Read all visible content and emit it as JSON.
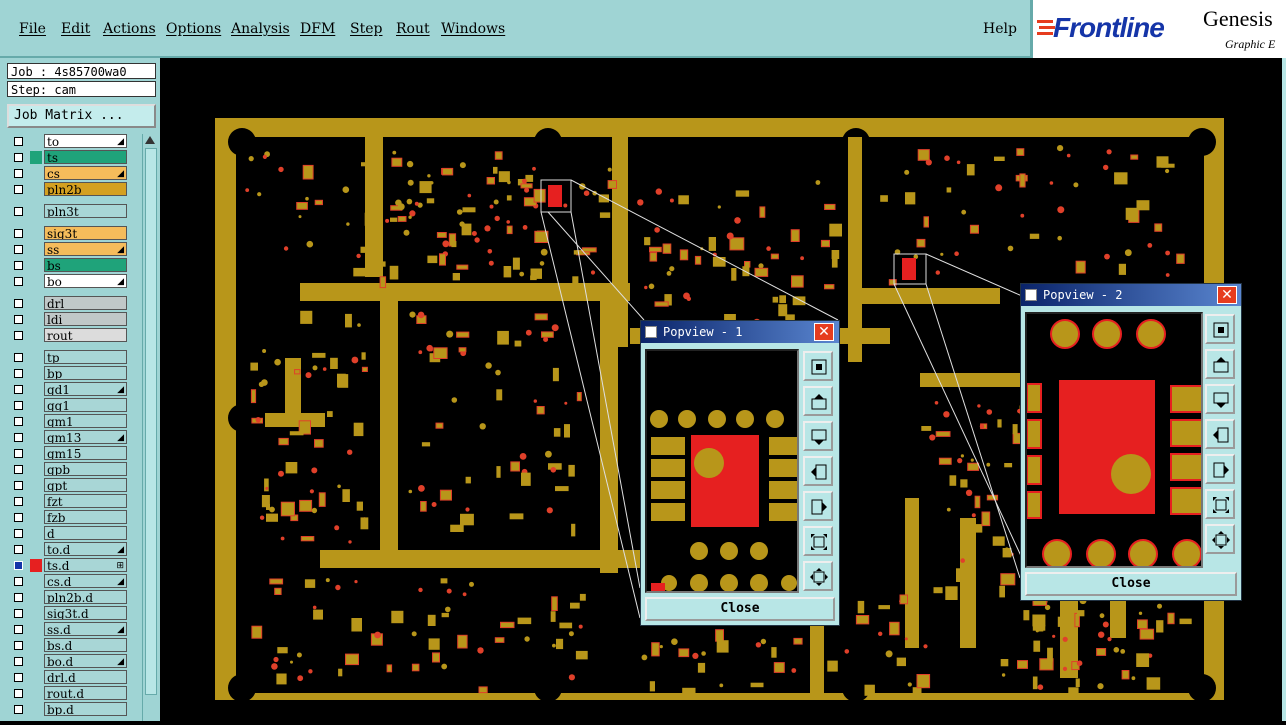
{
  "menu": {
    "items": [
      "File",
      "Edit",
      "Actions",
      "Options",
      "Analysis",
      "DFM",
      "Step",
      "Rout",
      "Windows"
    ],
    "help": "Help"
  },
  "logo": {
    "brand": "Frontline",
    "product": "Genesis",
    "tagline": "Graphic E"
  },
  "job": {
    "job_label": "Job : 4s85700wa0",
    "step_label": "Step: cam",
    "matrix_button": "Job Matrix ..."
  },
  "layers": [
    {
      "name": "to",
      "color": "#ffffff",
      "mark": "◢",
      "ind": ""
    },
    {
      "name": "ts",
      "color": "#1fa37a",
      "mark": "",
      "ind": "#1fa37a"
    },
    {
      "name": "cs",
      "color": "#f5bc5b",
      "mark": "◢",
      "ind": ""
    },
    {
      "name": "pln2b",
      "color": "#d4a020",
      "mark": "",
      "ind": ""
    },
    {
      "name": "pln3t",
      "color": "#a8d6d6",
      "mark": "",
      "ind": ""
    },
    {
      "name": "sig3t",
      "color": "#f5bc5b",
      "mark": "",
      "ind": ""
    },
    {
      "name": "ss",
      "color": "#f5bc5b",
      "mark": "◢",
      "ind": ""
    },
    {
      "name": "bs",
      "color": "#1fa37a",
      "mark": "",
      "ind": ""
    },
    {
      "name": "bo",
      "color": "#ffffff",
      "mark": "◢",
      "ind": ""
    },
    {
      "name": "drl",
      "color": "#c0c8c8",
      "mark": "",
      "ind": ""
    },
    {
      "name": "ldi",
      "color": "#c0c8c8",
      "mark": "",
      "ind": ""
    },
    {
      "name": "rout",
      "color": "#dcdcdc",
      "mark": "",
      "ind": ""
    },
    {
      "name": "tp",
      "color": "#a8d6d6",
      "mark": "",
      "ind": ""
    },
    {
      "name": "bp",
      "color": "#a8d6d6",
      "mark": "",
      "ind": ""
    },
    {
      "name": "gd1",
      "color": "#a8d6d6",
      "mark": "◢",
      "ind": ""
    },
    {
      "name": "gg1",
      "color": "#a8d6d6",
      "mark": "",
      "ind": ""
    },
    {
      "name": "gm1",
      "color": "#a8d6d6",
      "mark": "",
      "ind": ""
    },
    {
      "name": "gm13",
      "color": "#a8d6d6",
      "mark": "◢",
      "ind": ""
    },
    {
      "name": "gm15",
      "color": "#a8d6d6",
      "mark": "",
      "ind": ""
    },
    {
      "name": "gpb",
      "color": "#a8d6d6",
      "mark": "",
      "ind": ""
    },
    {
      "name": "gpt",
      "color": "#a8d6d6",
      "mark": "",
      "ind": ""
    },
    {
      "name": "fzt",
      "color": "#a8d6d6",
      "mark": "",
      "ind": ""
    },
    {
      "name": "fzb",
      "color": "#a8d6d6",
      "mark": "",
      "ind": ""
    },
    {
      "name": "d",
      "color": "#a8d6d6",
      "mark": "",
      "ind": ""
    },
    {
      "name": "to.d",
      "color": "#a8d6d6",
      "mark": "◢",
      "ind": ""
    },
    {
      "name": "ts.d",
      "color": "#a8d6d6",
      "mark": "⊞",
      "ind": "#e62020",
      "checked": true
    },
    {
      "name": "cs.d",
      "color": "#a8d6d6",
      "mark": "◢",
      "ind": ""
    },
    {
      "name": "pln2b.d",
      "color": "#a8d6d6",
      "mark": "",
      "ind": ""
    },
    {
      "name": "sig3t.d",
      "color": "#a8d6d6",
      "mark": "",
      "ind": ""
    },
    {
      "name": "ss.d",
      "color": "#a8d6d6",
      "mark": "◢",
      "ind": ""
    },
    {
      "name": "bs.d",
      "color": "#a8d6d6",
      "mark": "",
      "ind": ""
    },
    {
      "name": "bo.d",
      "color": "#a8d6d6",
      "mark": "◢",
      "ind": ""
    },
    {
      "name": "drl.d",
      "color": "#a8d6d6",
      "mark": "",
      "ind": ""
    },
    {
      "name": "rout.d",
      "color": "#a8d6d6",
      "mark": "",
      "ind": ""
    },
    {
      "name": "bp.d",
      "color": "#a8d6d6",
      "mark": "",
      "ind": ""
    }
  ],
  "popview1": {
    "title": "Popview - 1",
    "close_label": "Close"
  },
  "popview2": {
    "title": "Popview - 2",
    "close_label": "Close"
  },
  "colors": {
    "copper": "#b8961a",
    "pad": "#e62020",
    "panel": "#9fd4d4",
    "title_bar": "#0a246a"
  }
}
